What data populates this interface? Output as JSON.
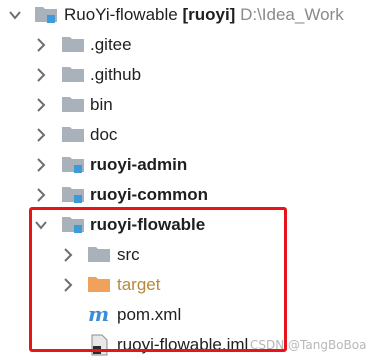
{
  "tree": {
    "root": {
      "name": "RuoYi-flowable",
      "tag": "[ruoyi]",
      "path": "D:\\Idea_Work"
    },
    "items": [
      {
        "label": ".gitee"
      },
      {
        "label": ".github"
      },
      {
        "label": "bin"
      },
      {
        "label": "doc"
      },
      {
        "label": "ruoyi-admin"
      },
      {
        "label": "ruoyi-common"
      },
      {
        "label": "ruoyi-flowable"
      },
      {
        "label": "src"
      },
      {
        "label": "target"
      },
      {
        "label": "pom.xml"
      },
      {
        "label": "ruoyi-flowable.iml"
      }
    ]
  },
  "watermark": "CSDN @TangBoBoa",
  "colors": {
    "highlight": "#e8141c",
    "folder": "#a9b2ba",
    "excluded_folder": "#f0a15c",
    "module_badge": "#3e9bd9",
    "maven": "#3b8ddb"
  }
}
